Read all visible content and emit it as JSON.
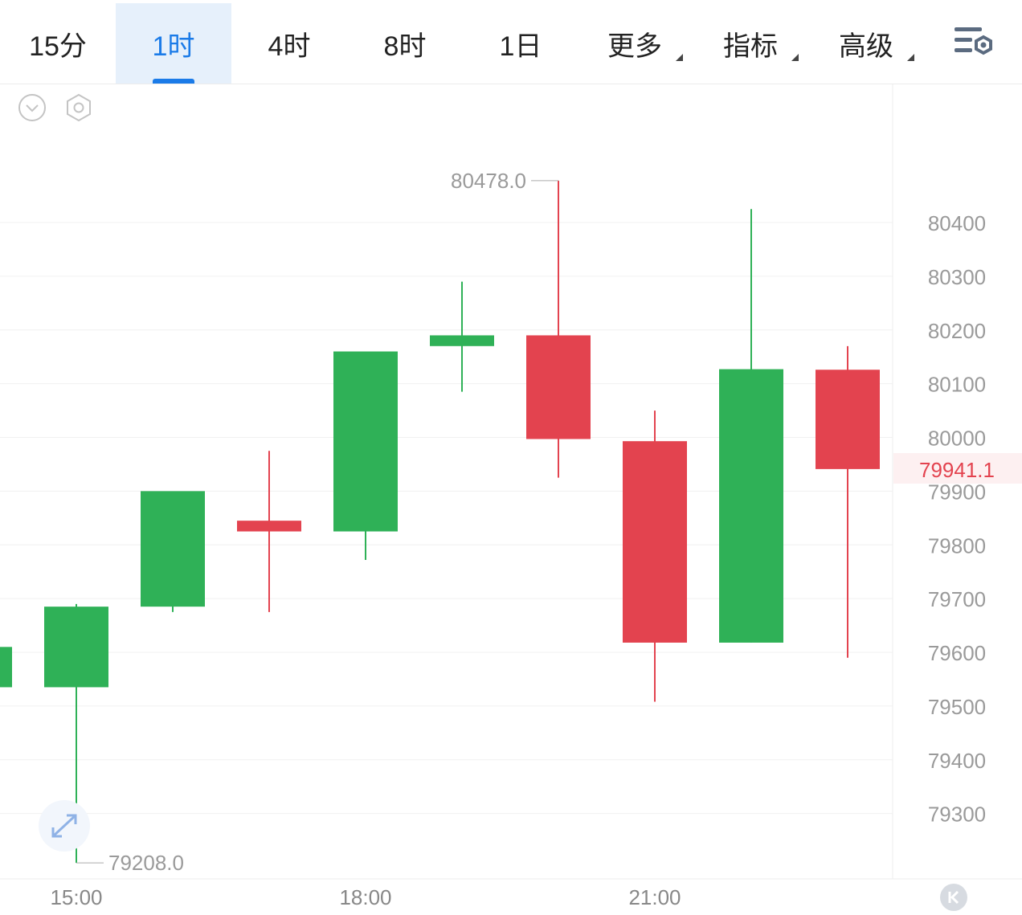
{
  "tabs": [
    {
      "label": "15分",
      "active": false,
      "dropdown": false
    },
    {
      "label": "1时",
      "active": true,
      "dropdown": false
    },
    {
      "label": "4时",
      "active": false,
      "dropdown": false
    },
    {
      "label": "8时",
      "active": false,
      "dropdown": false
    },
    {
      "label": "1日",
      "active": false,
      "dropdown": false
    },
    {
      "label": "更多",
      "active": false,
      "dropdown": true
    },
    {
      "label": "指标",
      "active": false,
      "dropdown": true
    },
    {
      "label": "高级",
      "active": false,
      "dropdown": true
    }
  ],
  "toolbar_icons": [
    "chart-settings-icon",
    "collapse-chevron-icon",
    "hexagon-settings-icon",
    "fullscreen-expand-icon",
    "scroll-to-latest-icon"
  ],
  "colors": {
    "up": "#2fb157",
    "down": "#e3434f",
    "accent": "#1b7be8",
    "grid": "#f0f0f0",
    "axis_text": "#9a9a9a"
  },
  "chart_data": {
    "type": "candlestick",
    "x_tick_labels": [
      "15:00",
      "18:00",
      "21:00"
    ],
    "x_tick_index": [
      1,
      4,
      7
    ],
    "y_ticks": [
      79300,
      79400,
      79500,
      79600,
      79700,
      79800,
      79900,
      80000,
      80100,
      80200,
      80300,
      80400
    ],
    "ylim": [
      79160,
      80560
    ],
    "last_price": "79941.1",
    "high_label": "80478.0",
    "low_label": "79208.0",
    "grid": true,
    "candles": [
      {
        "o": 79535,
        "h": 79580,
        "c": 79610,
        "l": 79520
      },
      {
        "o": 79535,
        "h": 79690,
        "l": 79208,
        "c": 79685
      },
      {
        "o": 79685,
        "h": 79785,
        "l": 79675,
        "c": 79900
      },
      {
        "o": 79845,
        "h": 79975,
        "l": 79675,
        "c": 79825
      },
      {
        "o": 79825,
        "h": 80125,
        "l": 79772,
        "c": 80160
      },
      {
        "o": 80170,
        "h": 80290,
        "l": 80085,
        "c": 80190
      },
      {
        "o": 80190,
        "h": 80478,
        "l": 79925,
        "c": 79997
      },
      {
        "o": 79993,
        "h": 80050,
        "l": 79508,
        "c": 79618
      },
      {
        "o": 79618,
        "h": 80425,
        "l": 79618,
        "c": 80127
      },
      {
        "o": 80126,
        "h": 80170,
        "l": 79590,
        "c": 79941.1
      }
    ]
  }
}
